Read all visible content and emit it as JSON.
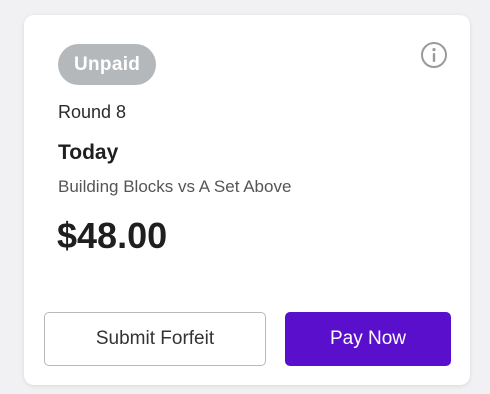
{
  "card": {
    "status_badge": "Unpaid",
    "round": "Round 8",
    "date": "Today",
    "matchup": "Building Blocks vs A Set Above",
    "amount": "$48.00",
    "info_icon": "info-circle-icon"
  },
  "actions": {
    "forfeit_label": "Submit Forfeit",
    "pay_label": "Pay Now"
  },
  "colors": {
    "badge_bg": "#b4b8bb",
    "primary": "#5a0fcc",
    "page_bg": "#f1f1f3"
  }
}
